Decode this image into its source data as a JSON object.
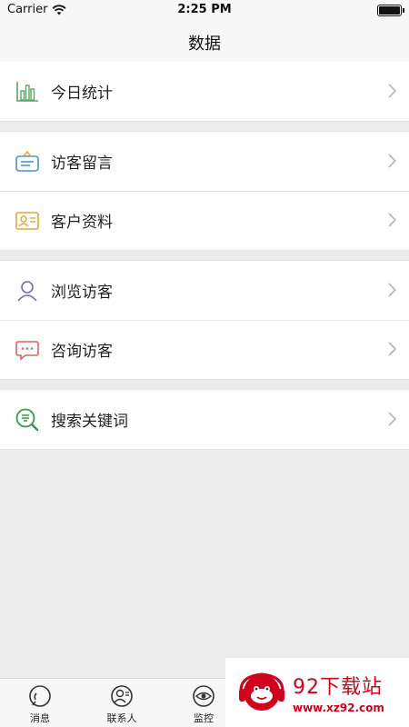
{
  "status_bar": {
    "carrier": "Carrier",
    "time": "2:25 PM"
  },
  "nav": {
    "title": "数据"
  },
  "groups": [
    {
      "items": [
        {
          "label": "今日统计",
          "icon": "bar-chart-icon"
        }
      ]
    },
    {
      "items": [
        {
          "label": "访客留言",
          "icon": "message-board-icon"
        },
        {
          "label": "客户资料",
          "icon": "id-card-icon"
        }
      ]
    },
    {
      "items": [
        {
          "label": "浏览访客",
          "icon": "visitor-icon"
        },
        {
          "label": "咨询访客",
          "icon": "chat-bubble-icon"
        }
      ]
    },
    {
      "items": [
        {
          "label": "搜索关键词",
          "icon": "keyword-search-icon"
        }
      ]
    }
  ],
  "tabs": [
    {
      "label": "消息",
      "icon": "message-icon"
    },
    {
      "label": "联系人",
      "icon": "contacts-icon"
    },
    {
      "label": "监控",
      "icon": "monitor-eye-icon"
    }
  ],
  "watermark": {
    "title": "92下载站",
    "url": "www.xz92.com"
  },
  "colors": {
    "chart_green": "#5aa469",
    "message_blue": "#4a90d9",
    "card_orange": "#e8a43a",
    "visitor_purple": "#6b6bc9",
    "chat_red": "#e2625e",
    "keyword_green": "#2e9e3e",
    "watermark_red": "#d0021b"
  }
}
